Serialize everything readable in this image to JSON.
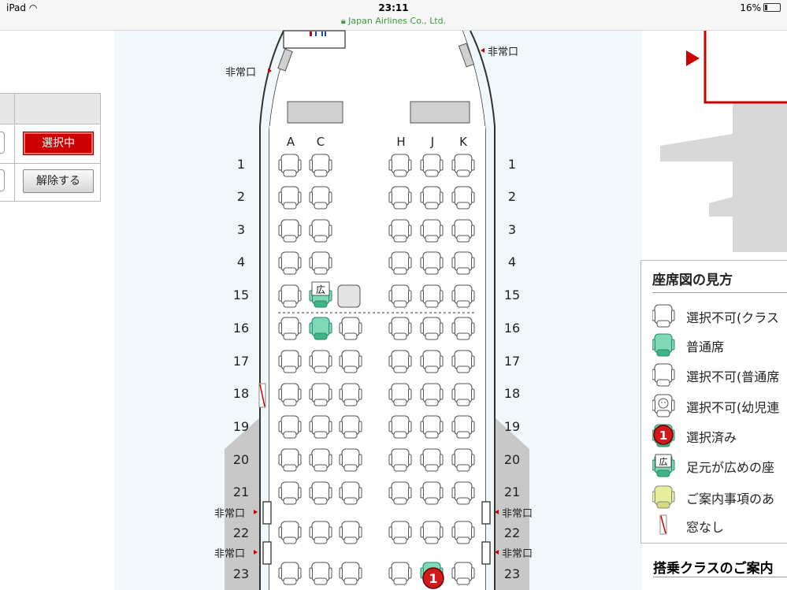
{
  "status_bar": {
    "device": "iPad",
    "time": "23:11",
    "url": "Japan Airlines Co., Ltd.",
    "battery": "16%"
  },
  "left_panel": {
    "selected_button": "選択中",
    "release_button": "解除する"
  },
  "seat_map": {
    "columns": [
      "A",
      "C",
      "H",
      "J",
      "K"
    ],
    "rows": [
      "1",
      "2",
      "3",
      "4",
      "15",
      "16",
      "17",
      "18",
      "19",
      "20",
      "21",
      "22",
      "23"
    ],
    "exit_label": "非常口",
    "wide_legroom_mark": "広",
    "selected_badge": "1",
    "colors": {
      "normal_green": "#7fd9b9",
      "selected_red": "#d11a1a",
      "fuselage_gray": "#c8c8c8"
    }
  },
  "legend": {
    "title": "座席図の見方",
    "items": [
      {
        "icon": "seat-unavailable-class-icon",
        "label": "選択不可(クラス"
      },
      {
        "icon": "seat-normal-icon",
        "label": "普通席"
      },
      {
        "icon": "seat-unavailable-normal-icon",
        "label": "選択不可(普通席"
      },
      {
        "icon": "seat-unavailable-infant-icon",
        "label": "選択不可(幼児連"
      },
      {
        "icon": "seat-selected-icon",
        "label": "選択済み"
      },
      {
        "icon": "seat-wide-icon",
        "label": "足元が広めの座"
      },
      {
        "icon": "seat-notice-icon",
        "label": "ご案内事項のあ"
      },
      {
        "icon": "no-window-icon",
        "label": "窓なし"
      }
    ]
  },
  "class_info_title": "搭乗クラスのご案内"
}
